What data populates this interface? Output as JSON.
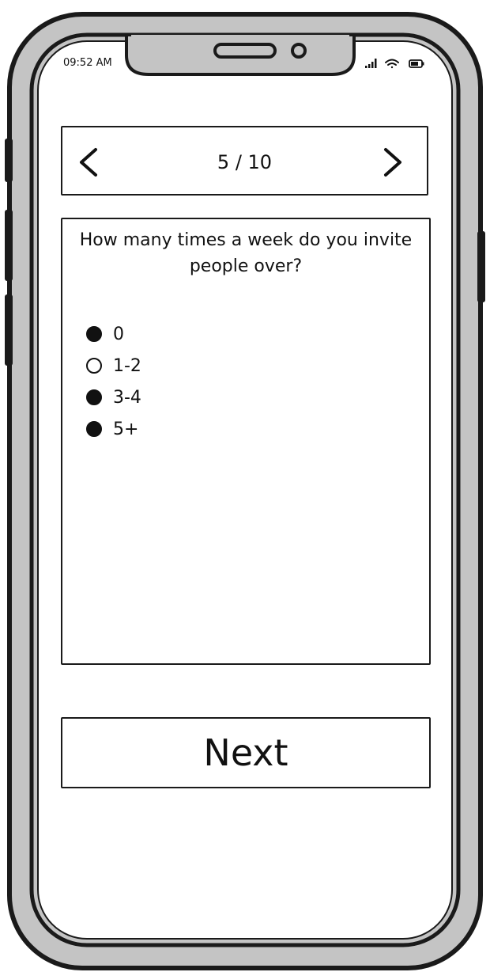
{
  "status_bar": {
    "time": "09:52 AM",
    "icons": [
      "signal-icon",
      "wifi-icon",
      "battery-icon"
    ]
  },
  "pager": {
    "label": "5 / 10",
    "prev_icon": "chevron-left-icon",
    "next_icon": "chevron-right-icon"
  },
  "question": {
    "text": "How many times a week do you invite people over?",
    "options": [
      {
        "label": "0",
        "selected": true
      },
      {
        "label": "1-2",
        "selected": false
      },
      {
        "label": "3-4",
        "selected": true
      },
      {
        "label": "5+",
        "selected": true
      }
    ]
  },
  "footer": {
    "next_label": "Next"
  }
}
